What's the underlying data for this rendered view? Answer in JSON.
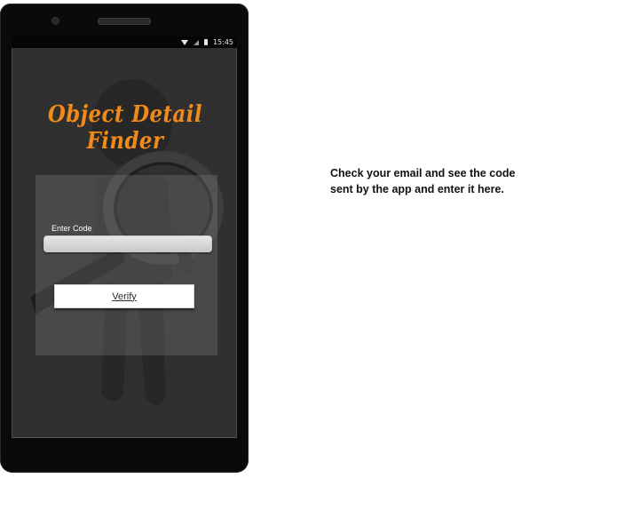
{
  "statusbar": {
    "time": "15:45",
    "icons": [
      "wifi-icon",
      "signal-icon",
      "battery-icon"
    ]
  },
  "app": {
    "title": "Object Detail Finder",
    "title_color": "#f08a1a"
  },
  "form": {
    "code_label": "Enter Code",
    "code_value": "",
    "verify_label": "Verify"
  },
  "instructions": {
    "line1": "Check your email and see the code",
    "line2": "sent by the app and enter it here."
  }
}
